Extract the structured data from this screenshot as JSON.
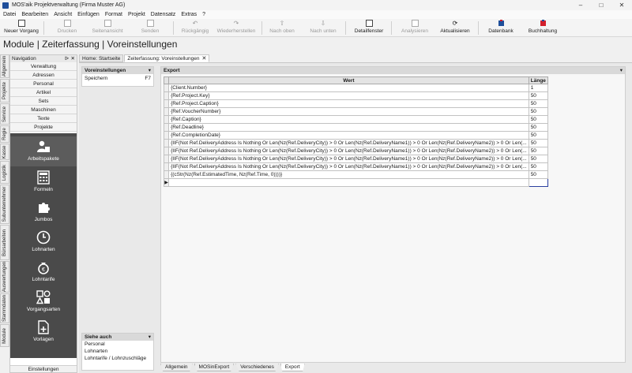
{
  "window": {
    "title": "MOS'aik Projektverwaltung (Firma Muster AG)",
    "controls": [
      "–",
      "□",
      "✕"
    ]
  },
  "menu": [
    "Datei",
    "Bearbeiten",
    "Ansicht",
    "Einfügen",
    "Format",
    "Projekt",
    "Datensatz",
    "Extras",
    "?"
  ],
  "toolbar": {
    "new_label": "Neuer Vorgang",
    "print_label": "Drucken",
    "preview_label": "Seitenansicht",
    "send_label": "Senden",
    "undo_label": "Rückgängig",
    "redo_label": "Wiederherstellen",
    "up_label": "Nach oben",
    "down_label": "Nach unten",
    "detail_label": "Detailfenster",
    "analyze_label": "Analysieren",
    "refresh_label": "Aktualisieren",
    "database_label": "Datenbank",
    "accounting_label": "Buchhaltung"
  },
  "page_title": "Module | Zeiterfassung | Voreinstellungen",
  "navigation": {
    "title": "Navigation",
    "pin": "ᐅ",
    "close": "✕",
    "items": [
      "Verwaltung",
      "Adressen",
      "Personal",
      "Artikel",
      "Sets",
      "Maschinen",
      "Texte",
      "Projekte"
    ],
    "modules": [
      "Arbeitspakete",
      "Formeln",
      "Jumbos",
      "Lohnarten",
      "Lohntarife",
      "Vorgangsarten",
      "Vorlagen"
    ],
    "footer": "Einstellungen"
  },
  "side_tabs": [
    "Allgemein",
    "Projekte",
    "Service",
    "Regie",
    "Kasse",
    "Logistik",
    "Subunternehmer",
    "Bürsarbeiten",
    "Auswertungen",
    "Stammdaten",
    "Module"
  ],
  "doc_tabs": [
    {
      "label": "Home: Startseite",
      "close": ""
    },
    {
      "label": "Zeiterfassung: Voreinstellungen",
      "close": "✕"
    }
  ],
  "voreinstellungen": {
    "title": "Voreinstellungen",
    "items": [
      {
        "label": "Speichern",
        "shortcut": "F7"
      }
    ]
  },
  "siehe_auch": {
    "title": "Siehe auch",
    "links": [
      "Personal",
      "Lohnarten",
      "Lohntarife / Lohnzuschläge"
    ]
  },
  "export": {
    "title": "Export",
    "columns": [
      "Wert",
      "Länge"
    ],
    "rows": [
      {
        "wert": "{Client.Number}",
        "laenge": "1"
      },
      {
        "wert": "{Ref.Project.Key}",
        "laenge": "50"
      },
      {
        "wert": "{Ref.Project.Caption}",
        "laenge": "50"
      },
      {
        "wert": "{Ref.VoucherNumber}",
        "laenge": "50"
      },
      {
        "wert": "{Ref.Caption}",
        "laenge": "50"
      },
      {
        "wert": "{Ref.Deadline}",
        "laenge": "50"
      },
      {
        "wert": "{Ref.CompletionDate}",
        "laenge": "50"
      },
      {
        "wert": "{IIF(Not Ref.DeliveryAddress Is Nothing Or Len(Nz(Ref.DeliveryCity)) > 0 Or Len(Nz(Ref.DeliveryName1)) > 0 Or Len(Nz(Ref.DeliveryName2)) > 0 Or Len(...",
        "laenge": "50"
      },
      {
        "wert": "{IIF(Not Ref.DeliveryAddress Is Nothing Or Len(Nz(Ref.DeliveryCity)) > 0 Or Len(Nz(Ref.DeliveryName1)) > 0 Or Len(Nz(Ref.DeliveryName2)) > 0 Or Len(...",
        "laenge": "50"
      },
      {
        "wert": "{IIF(Not Ref.DeliveryAddress Is Nothing Or Len(Nz(Ref.DeliveryCity)) > 0 Or Len(Nz(Ref.DeliveryName1)) > 0 Or Len(Nz(Ref.DeliveryName2)) > 0 Or Len(...",
        "laenge": "50"
      },
      {
        "wert": "{IIF(Not Ref.DeliveryAddress Is Nothing Or Len(Nz(Ref.DeliveryCity)) > 0 Or Len(Nz(Ref.DeliveryName1)) > 0 Or Len(Nz(Ref.DeliveryName2)) > 0 Or Len(...",
        "laenge": "50"
      },
      {
        "wert": "{(cStr(Nz(Ref.EstimatedTime, Nz(Ref.Time, 0))))}",
        "laenge": "50"
      }
    ],
    "new_row_marker": "▶"
  },
  "bottom_tabs": [
    "Allgemein",
    "MOSinExport",
    "Verschiedenes",
    "Export"
  ],
  "colors": {
    "accent_blue": "#1f4e9a",
    "dark_nav": "#4a4a4a",
    "selected_cell_border": "#2a3f9f"
  }
}
